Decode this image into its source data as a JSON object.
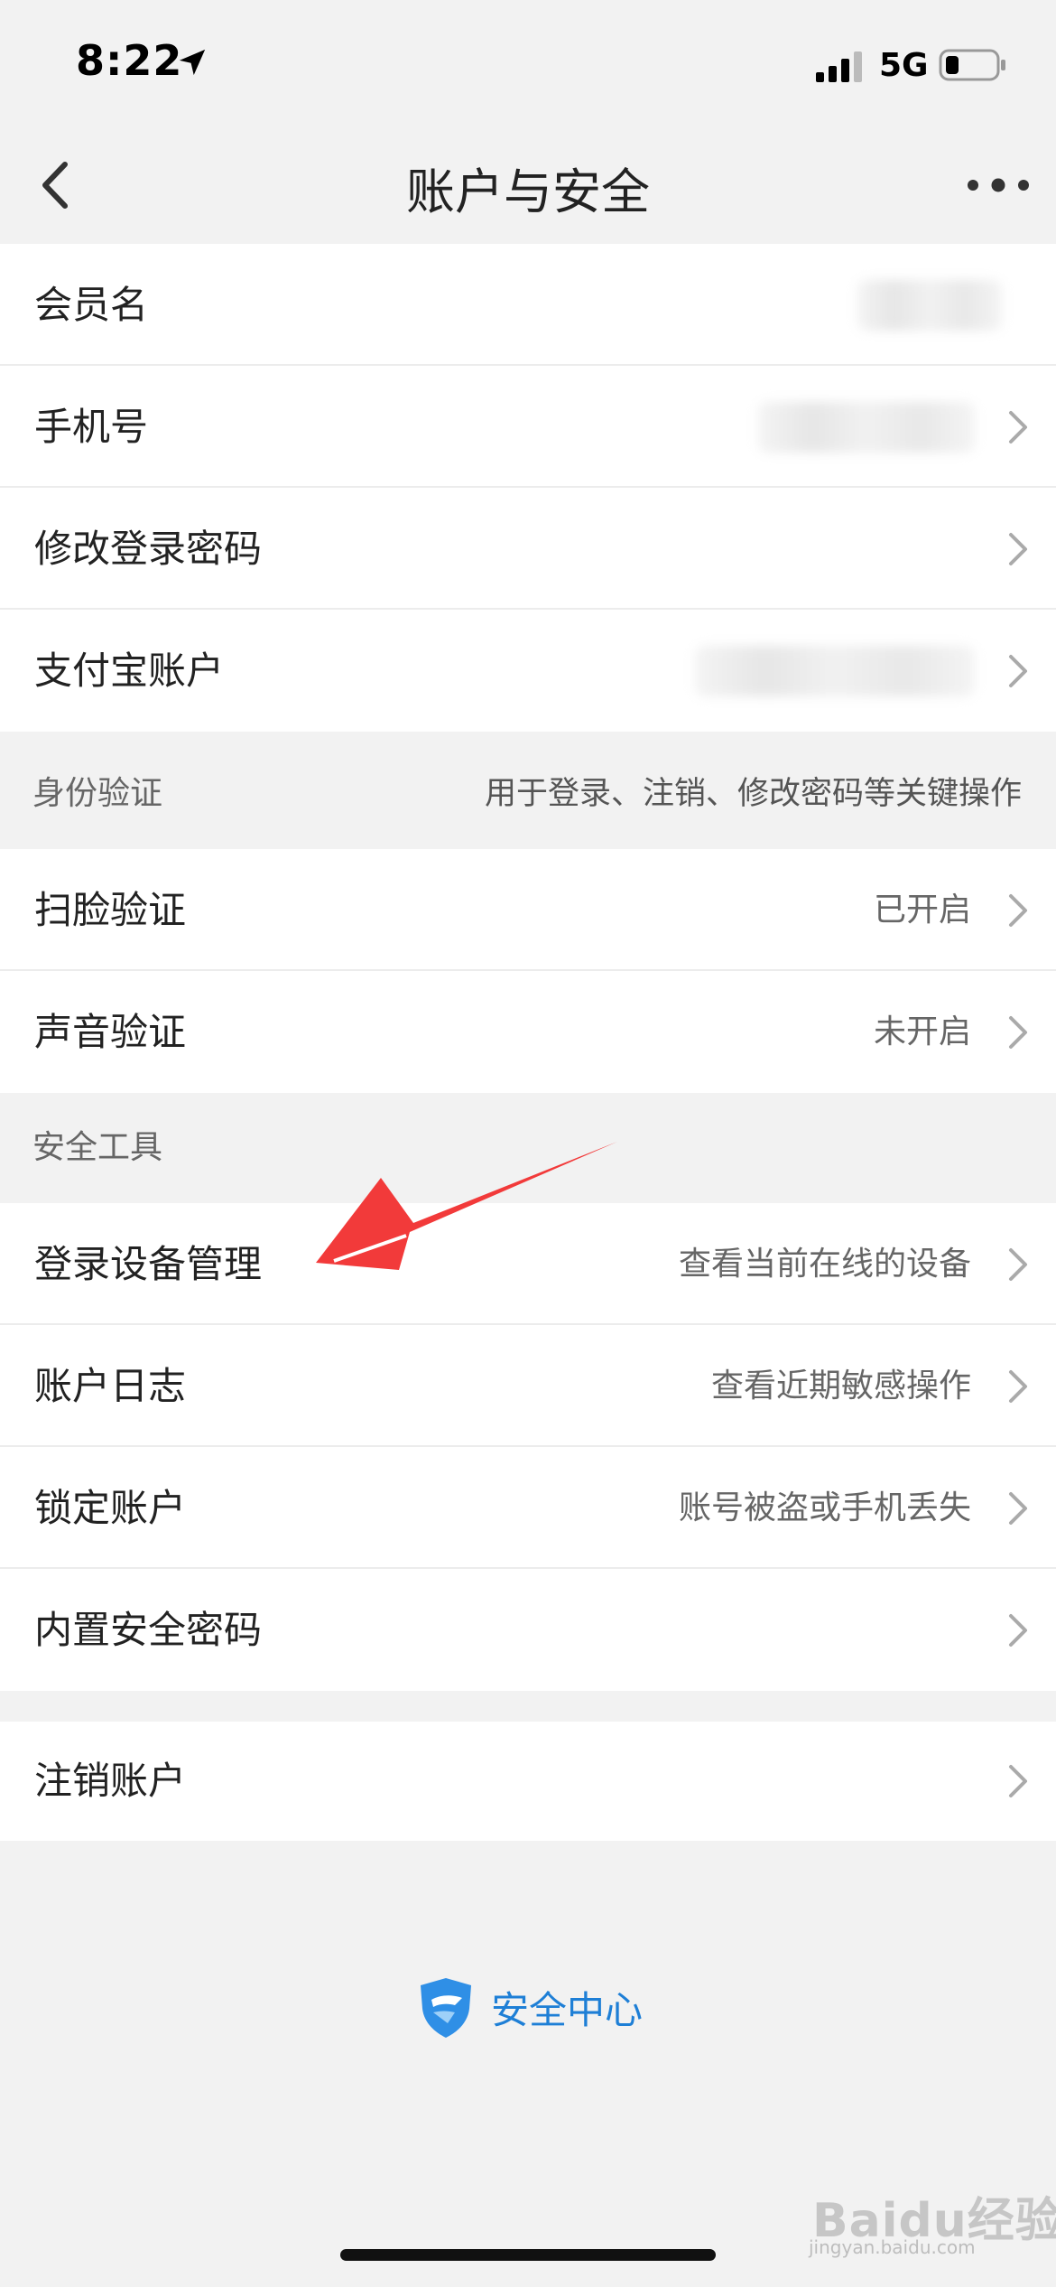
{
  "status_bar": {
    "time": "8:22",
    "network": "5G"
  },
  "nav": {
    "title": "账户与安全"
  },
  "account_rows": [
    {
      "label": "会员名"
    },
    {
      "label": "手机号"
    },
    {
      "label": "修改登录密码"
    },
    {
      "label": "支付宝账户"
    }
  ],
  "identity_section": {
    "title": "身份验证",
    "note": "用于登录、注销、修改密码等关键操作",
    "rows": [
      {
        "label": "扫脸验证",
        "value": "已开启"
      },
      {
        "label": "声音验证",
        "value": "未开启"
      }
    ]
  },
  "tools_section": {
    "title": "安全工具",
    "rows": [
      {
        "label": "登录设备管理",
        "value": "查看当前在线的设备"
      },
      {
        "label": "账户日志",
        "value": "查看近期敏感操作"
      },
      {
        "label": "锁定账户",
        "value": "账号被盗或手机丢失"
      },
      {
        "label": "内置安全密码",
        "value": ""
      }
    ]
  },
  "close_account": {
    "label": "注销账户"
  },
  "footer": {
    "security_center_label": "安全中心"
  },
  "watermark": {
    "text": "Baidu经验",
    "sub": "jingyan.baidu.com"
  },
  "colors": {
    "background": "#f2f2f2",
    "card": "#ffffff",
    "accent": "#1e7fd6",
    "annotation": "#f23a3a"
  }
}
